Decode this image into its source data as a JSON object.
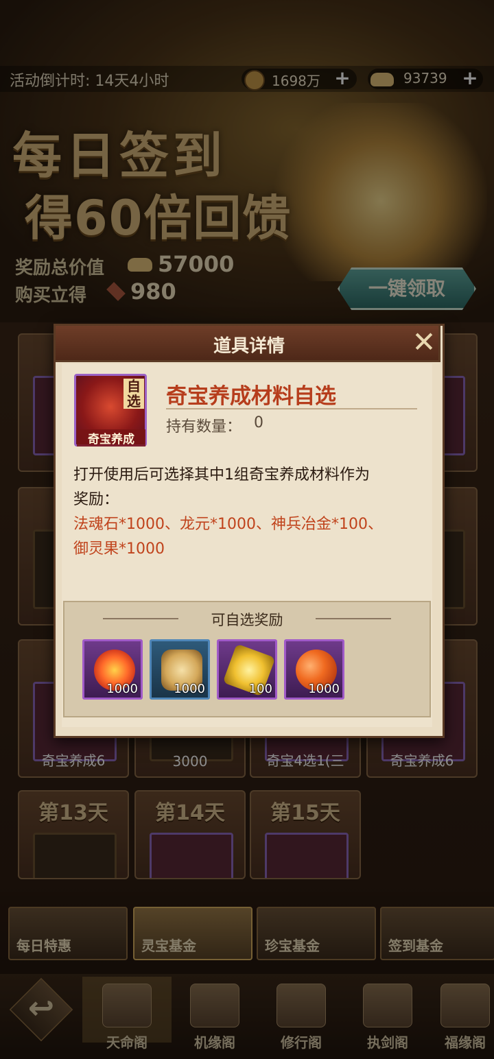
{
  "top_bar": {
    "countdown": "活动倒计时: 14天4小时",
    "coins": "1698万",
    "ingots": "93739",
    "plus": "+"
  },
  "banner": {
    "title_line1": "每日签到",
    "title_line2": "得60倍回馈",
    "total_value_label": "奖励总价值",
    "total_value": "57000",
    "buy_label": "购买立得",
    "buy_value": "980",
    "claim_all": "一键领取"
  },
  "day_cards": [
    {
      "label": "第13天",
      "foot": ""
    },
    {
      "label": "第14天",
      "foot": ""
    },
    {
      "label": "第15天",
      "foot": ""
    }
  ],
  "background_texts": {
    "row3_foot_a": "奇宝养成6",
    "row3_foot_b": "3000",
    "row3_foot_c": "奇宝4选1(三",
    "row3_foot_d": "奇宝养成6"
  },
  "tabs": [
    {
      "label": "每日特惠"
    },
    {
      "label": "灵宝基金"
    },
    {
      "label": "珍宝基金"
    },
    {
      "label": "签到基金"
    }
  ],
  "nav": [
    {
      "label": "天命阁"
    },
    {
      "label": "机缘阁"
    },
    {
      "label": "修行阁"
    },
    {
      "label": "执剑阁"
    },
    {
      "label": "福缘阁"
    }
  ],
  "dialog": {
    "title": "道具详情",
    "close": "✕",
    "item_name": "奇宝养成材料自选",
    "icon_tag": "自选",
    "icon_label": "奇宝养成",
    "owned_label": "持有数量：",
    "owned_value": "0",
    "desc_line1": "打开使用后可选择其中1组奇宝养成材料作为",
    "desc_line2": "奖励：",
    "reward_line1": "法魂石*1000、龙元*1000、神兵冶金*100、",
    "reward_line2": "御灵果*1000",
    "choices_title": "可自选奖励",
    "choices": [
      {
        "name": "法魂石",
        "qty": "1000",
        "border": "#a05ac8"
      },
      {
        "name": "龙元",
        "qty": "1000",
        "border": "#4f86b8"
      },
      {
        "name": "神兵冶金",
        "qty": "100",
        "border": "#a05ac8"
      },
      {
        "name": "御灵果",
        "qty": "1000",
        "border": "#a05ac8"
      }
    ]
  }
}
